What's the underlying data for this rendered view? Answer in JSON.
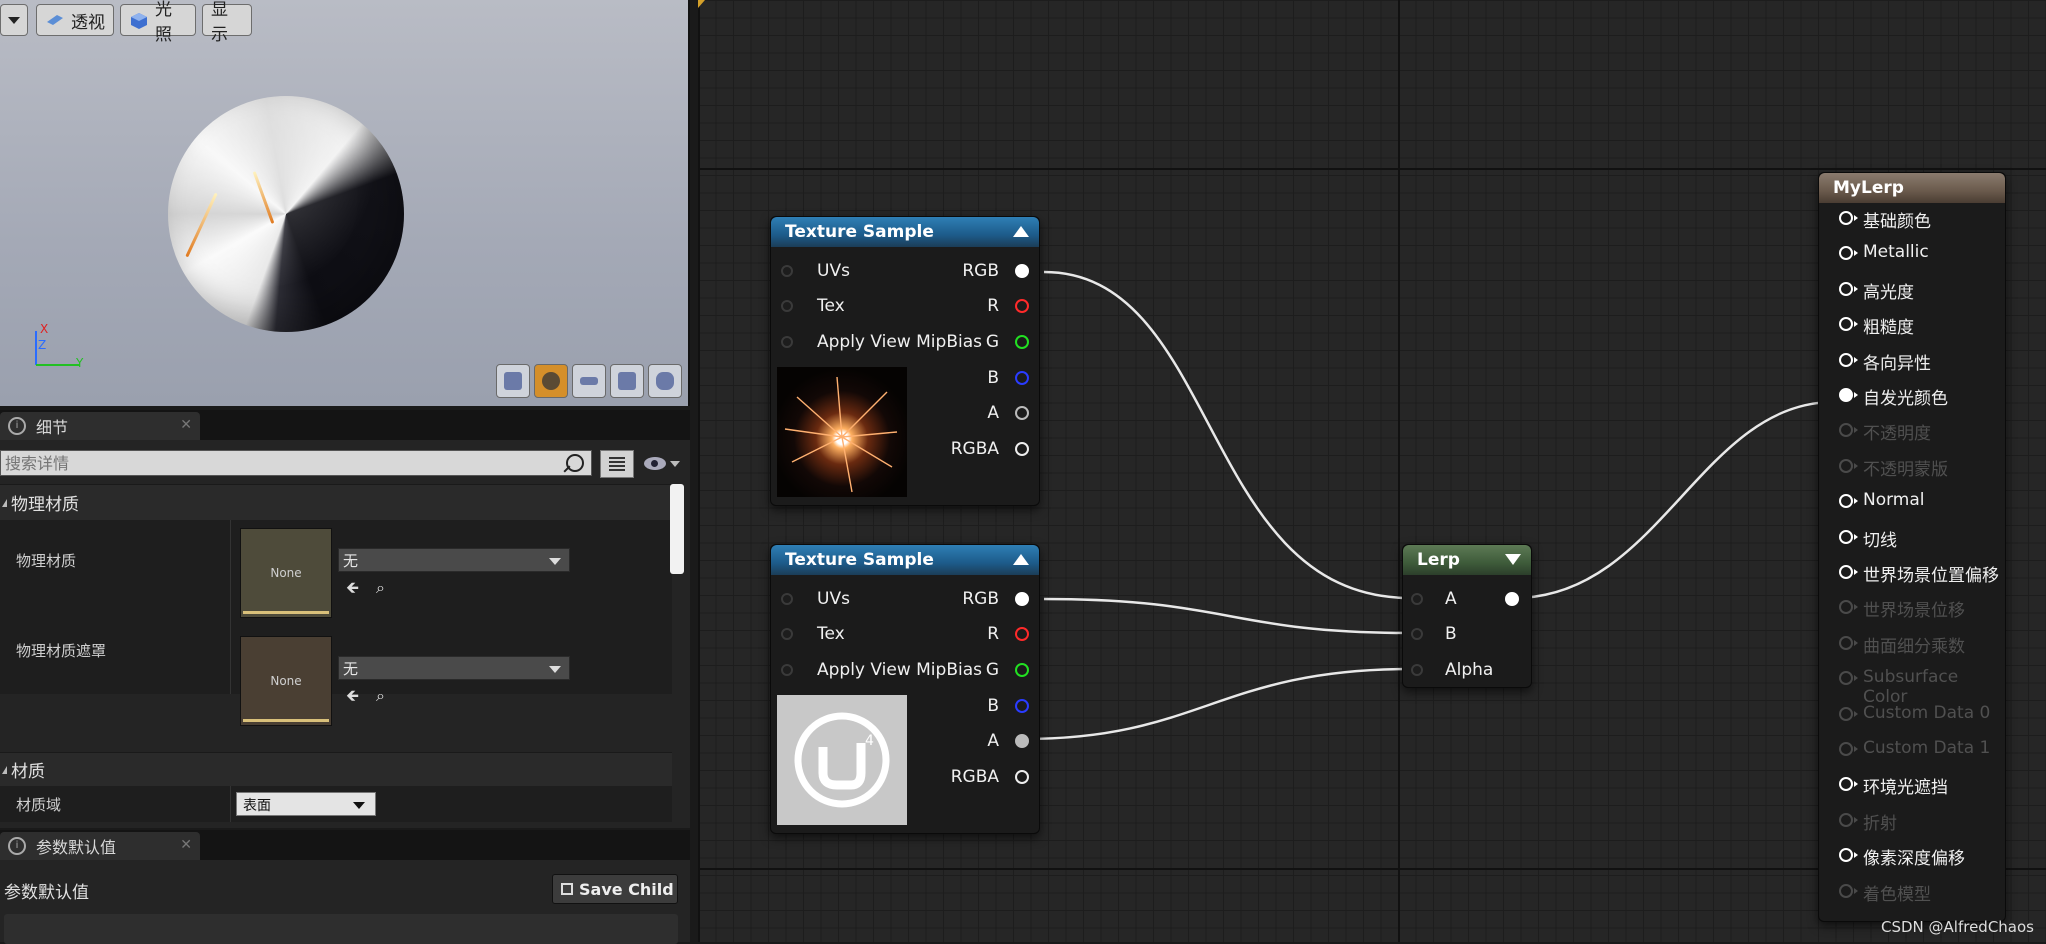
{
  "viewport": {
    "persp_label": "透视",
    "light_label": "光照",
    "show_label": "显示",
    "axis_x": "X",
    "axis_y": "Y",
    "axis_z": "Z"
  },
  "details": {
    "tab_label": "细节",
    "search_placeholder": "搜索详情",
    "section_phys": "物理材质",
    "phys_material_label": "物理材质",
    "phys_material_thumb": "None",
    "phys_material_value": "无",
    "phys_mask_label": "物理材质遮罩",
    "phys_mask_thumb": "None",
    "phys_mask_value": "无",
    "section_material": "材质",
    "domain_label": "材质域",
    "domain_value": "表面"
  },
  "params": {
    "tab_label": "参数默认值",
    "header": "参数默认值",
    "save_child": "Save Child"
  },
  "colors": {
    "accent": "#d58f2a",
    "tex_header": "#2f7fb5",
    "lerp_header": "#5d7a55",
    "result_header": "#8a7b6e",
    "pin_red": "#ff2a2a",
    "pin_green": "#22e022",
    "pin_blue": "#2a3cff"
  },
  "nodes": {
    "tex1": {
      "title": "Texture Sample",
      "inputs": [
        "UVs",
        "Tex",
        "Apply View MipBias"
      ],
      "outputs": [
        "RGB",
        "R",
        "G",
        "B",
        "A",
        "RGBA"
      ]
    },
    "tex2": {
      "title": "Texture Sample",
      "inputs": [
        "UVs",
        "Tex",
        "Apply View MipBias"
      ],
      "outputs": [
        "RGB",
        "R",
        "G",
        "B",
        "A",
        "RGBA"
      ]
    },
    "lerp": {
      "title": "Lerp",
      "inputs": [
        "A",
        "B",
        "Alpha"
      ]
    },
    "result": {
      "title": "MyLerp",
      "pins": [
        "基础颜色",
        "Metallic",
        "高光度",
        "粗糙度",
        "各向异性",
        "自发光颜色",
        "不透明度",
        "不透明蒙版",
        "Normal",
        "切线",
        "世界场景位置偏移",
        "世界场景位移",
        "曲面细分乘数",
        "Subsurface Color",
        "Custom Data 0",
        "Custom Data 1",
        "环境光遮挡",
        "折射",
        "像素深度偏移",
        "着色模型"
      ]
    }
  },
  "watermark": "CSDN @AlfredChaos"
}
